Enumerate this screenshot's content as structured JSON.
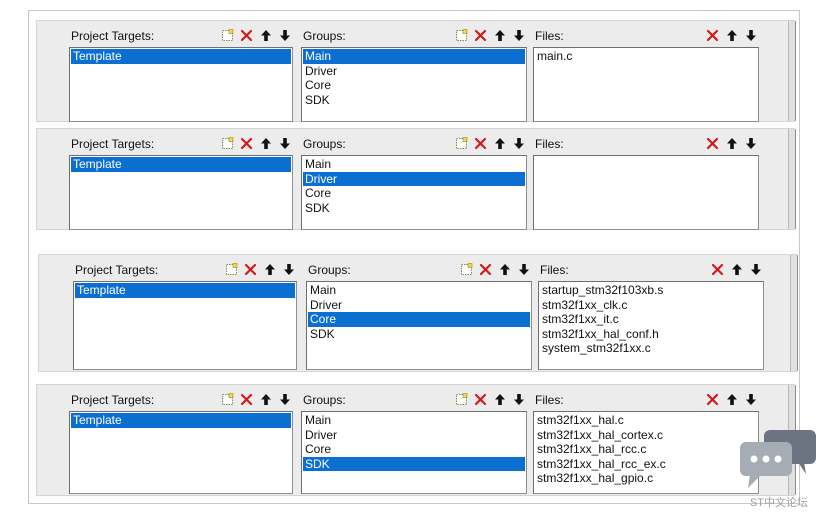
{
  "rows": [
    {
      "targets": {
        "title": "Project Targets:",
        "items": [
          {
            "label": "Template",
            "selected": true
          }
        ]
      },
      "groups": {
        "title": "Groups:",
        "items": [
          {
            "label": "Main",
            "selected": true
          },
          {
            "label": "Driver",
            "selected": false
          },
          {
            "label": "Core",
            "selected": false
          },
          {
            "label": "SDK",
            "selected": false
          }
        ]
      },
      "files": {
        "title": "Files:",
        "items": [
          {
            "label": "main.c",
            "selected": false
          }
        ]
      }
    },
    {
      "targets": {
        "title": "Project Targets:",
        "items": [
          {
            "label": "Template",
            "selected": true
          }
        ]
      },
      "groups": {
        "title": "Groups:",
        "items": [
          {
            "label": "Main",
            "selected": false
          },
          {
            "label": "Driver",
            "selected": true
          },
          {
            "label": "Core",
            "selected": false
          },
          {
            "label": "SDK",
            "selected": false
          }
        ]
      },
      "files": {
        "title": "Files:",
        "items": []
      }
    },
    {
      "targets": {
        "title": "Project Targets:",
        "items": [
          {
            "label": "Template",
            "selected": true
          }
        ]
      },
      "groups": {
        "title": "Groups:",
        "items": [
          {
            "label": "Main",
            "selected": false
          },
          {
            "label": "Driver",
            "selected": false
          },
          {
            "label": "Core",
            "selected": true
          },
          {
            "label": "SDK",
            "selected": false
          }
        ]
      },
      "files": {
        "title": "Files:",
        "items": [
          {
            "label": "startup_stm32f103xb.s",
            "selected": false
          },
          {
            "label": "stm32f1xx_clk.c",
            "selected": false
          },
          {
            "label": "stm32f1xx_it.c",
            "selected": false
          },
          {
            "label": "stm32f1xx_hal_conf.h",
            "selected": false
          },
          {
            "label": "system_stm32f1xx.c",
            "selected": false
          }
        ]
      }
    },
    {
      "targets": {
        "title": "Project Targets:",
        "items": [
          {
            "label": "Template",
            "selected": true
          }
        ]
      },
      "groups": {
        "title": "Groups:",
        "items": [
          {
            "label": "Main",
            "selected": false
          },
          {
            "label": "Driver",
            "selected": false
          },
          {
            "label": "Core",
            "selected": false
          },
          {
            "label": "SDK",
            "selected": true
          }
        ]
      },
      "files": {
        "title": "Files:",
        "items": [
          {
            "label": "stm32f1xx_hal.c",
            "selected": false
          },
          {
            "label": "stm32f1xx_hal_cortex.c",
            "selected": false
          },
          {
            "label": "stm32f1xx_hal_rcc.c",
            "selected": false
          },
          {
            "label": "stm32f1xx_hal_rcc_ex.c",
            "selected": false
          },
          {
            "label": "stm32f1xx_hal_gpio.c",
            "selected": false
          }
        ]
      }
    }
  ],
  "toolbar": {
    "new_icon": "new-icon",
    "delete_icon": "delete-icon",
    "up_icon": "move-up-icon",
    "down_icon": "move-down-icon"
  },
  "colors": {
    "selection": "#0a6fd1",
    "delete": "#d21a1a",
    "panel_bg": "#ececec"
  },
  "watermark": {
    "text": "ST中文论坛"
  }
}
